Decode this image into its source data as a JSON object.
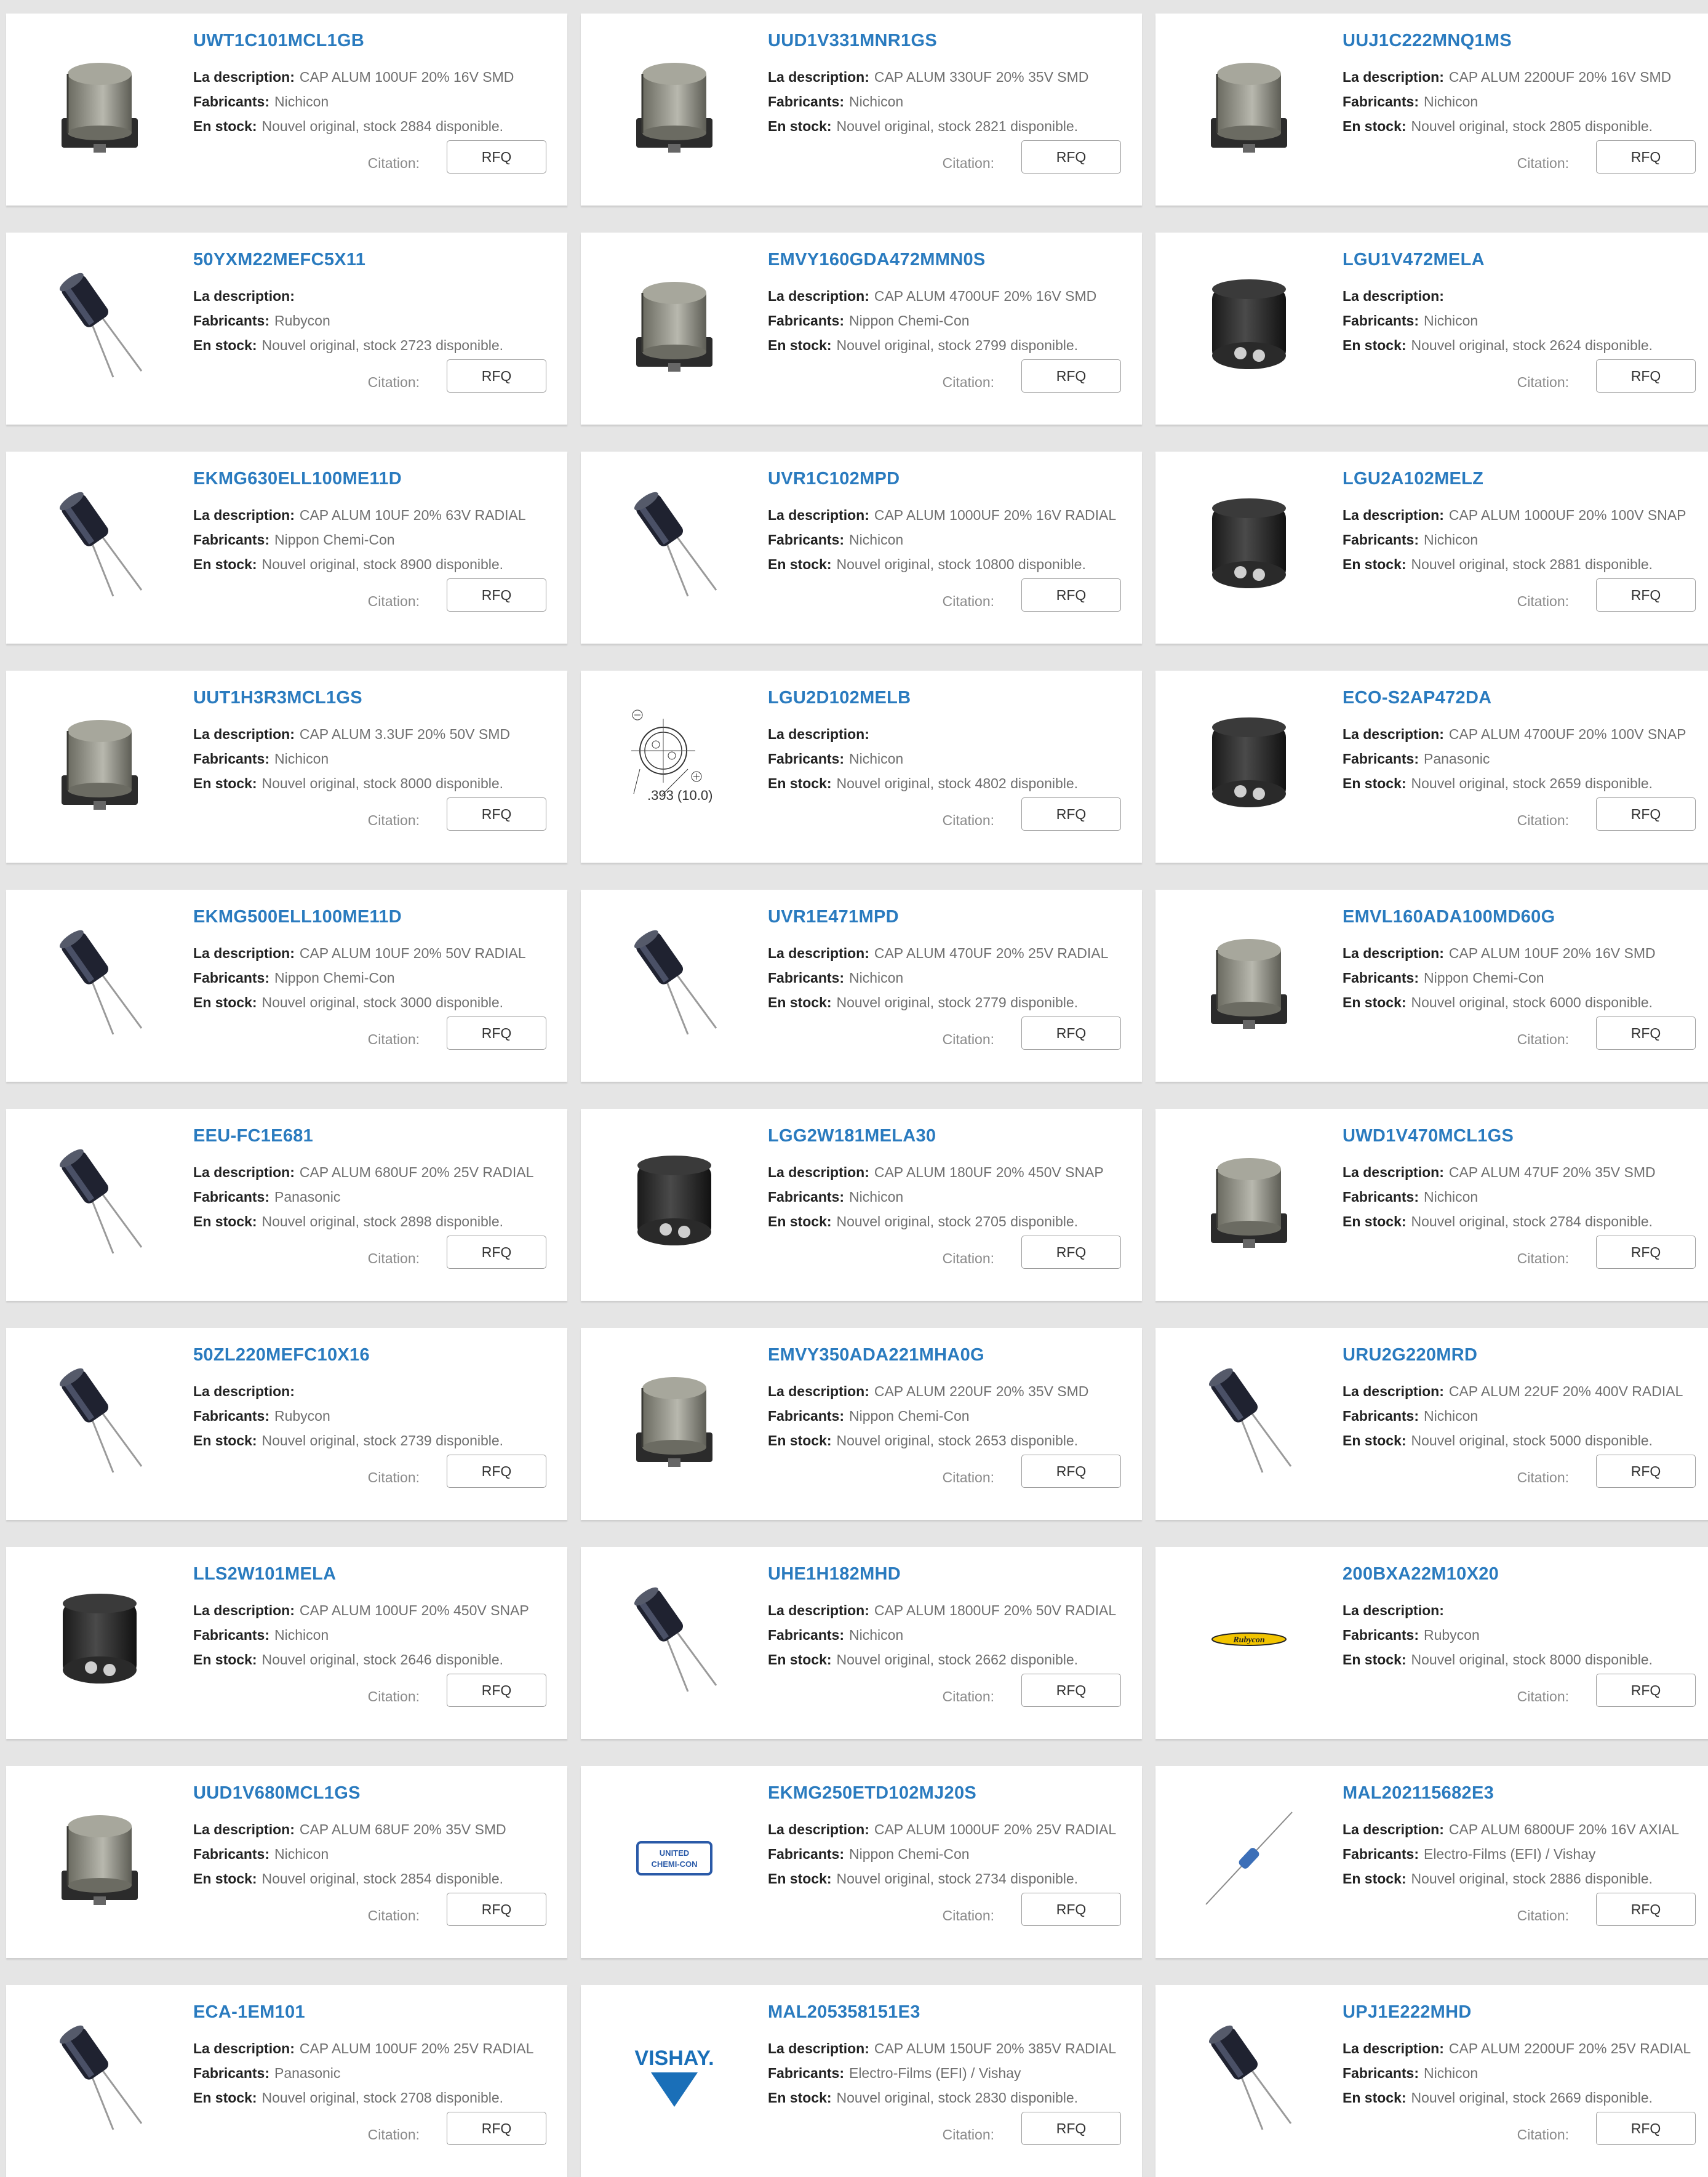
{
  "labels": {
    "description": "La description:",
    "manufacturer": "Fabricants:",
    "stock": "En stock:",
    "quote": "Citation:",
    "rfq": "RFQ"
  },
  "products": [
    {
      "part": "UWT1C101MCL1GB",
      "desc": "CAP ALUM 100UF 20% 16V SMD",
      "mfr": "Nichicon",
      "stock": "Nouvel original, stock 2884 disponible.",
      "icon": "smd-capacitor-icon"
    },
    {
      "part": "UUD1V331MNR1GS",
      "desc": "CAP ALUM 330UF 20% 35V SMD",
      "mfr": "Nichicon",
      "stock": "Nouvel original, stock 2821 disponible.",
      "icon": "smd-capacitor-icon"
    },
    {
      "part": "UUJ1C222MNQ1MS",
      "desc": "CAP ALUM 2200UF 20% 16V SMD",
      "mfr": "Nichicon",
      "stock": "Nouvel original, stock 2805 disponible.",
      "icon": "smd-capacitor-icon"
    },
    {
      "part": "50YXM22MEFC5X11",
      "desc": "",
      "mfr": "Rubycon",
      "stock": "Nouvel original, stock 2723 disponible.",
      "icon": "radial-capacitor-icon"
    },
    {
      "part": "EMVY160GDA472MMN0S",
      "desc": "CAP ALUM 4700UF 20% 16V SMD",
      "mfr": "Nippon Chemi-Con",
      "stock": "Nouvel original, stock 2799 disponible.",
      "icon": "smd-capacitor-icon"
    },
    {
      "part": "LGU1V472MELA",
      "desc": "",
      "mfr": "Nichicon",
      "stock": "Nouvel original, stock 2624 disponible.",
      "icon": "snap-in-capacitor-icon"
    },
    {
      "part": "EKMG630ELL100ME11D",
      "desc": "CAP ALUM 10UF 20% 63V RADIAL",
      "mfr": "Nippon Chemi-Con",
      "stock": "Nouvel original, stock 8900 disponible.",
      "icon": "radial-capacitor-icon"
    },
    {
      "part": "UVR1C102MPD",
      "desc": "CAP ALUM 1000UF 20% 16V RADIAL",
      "mfr": "Nichicon",
      "stock": "Nouvel original, stock 10800 disponible.",
      "icon": "radial-capacitor-icon"
    },
    {
      "part": "LGU2A102MELZ",
      "desc": "CAP ALUM 1000UF 20% 100V SNAP",
      "mfr": "Nichicon",
      "stock": "Nouvel original, stock 2881 disponible.",
      "icon": "snap-in-capacitor-icon"
    },
    {
      "part": "UUT1H3R3MCL1GS",
      "desc": "CAP ALUM 3.3UF 20% 50V SMD",
      "mfr": "Nichicon",
      "stock": "Nouvel original, stock 8000 disponible.",
      "icon": "smd-capacitor-icon"
    },
    {
      "part": "LGU2D102MELB",
      "desc": "",
      "mfr": "Nichicon",
      "stock": "Nouvel original, stock 4802 disponible.",
      "icon": "dimension-drawing-icon",
      "drawing_text": ".393 (10.0)"
    },
    {
      "part": "ECO-S2AP472DA",
      "desc": "CAP ALUM 4700UF 20% 100V SNAP",
      "mfr": "Panasonic",
      "stock": "Nouvel original, stock 2659 disponible.",
      "icon": "snap-in-capacitor-icon"
    },
    {
      "part": "EKMG500ELL100ME11D",
      "desc": "CAP ALUM 10UF 20% 50V RADIAL",
      "mfr": "Nippon Chemi-Con",
      "stock": "Nouvel original, stock 3000 disponible.",
      "icon": "radial-capacitor-icon"
    },
    {
      "part": "UVR1E471MPD",
      "desc": "CAP ALUM 470UF 20% 25V RADIAL",
      "mfr": "Nichicon",
      "stock": "Nouvel original, stock 2779 disponible.",
      "icon": "radial-capacitor-icon"
    },
    {
      "part": "EMVL160ADA100MD60G",
      "desc": "CAP ALUM 10UF 20% 16V SMD",
      "mfr": "Nippon Chemi-Con",
      "stock": "Nouvel original, stock 6000 disponible.",
      "icon": "smd-capacitor-icon"
    },
    {
      "part": "EEU-FC1E681",
      "desc": "CAP ALUM 680UF 20% 25V RADIAL",
      "mfr": "Panasonic",
      "stock": "Nouvel original, stock 2898 disponible.",
      "icon": "radial-capacitor-icon"
    },
    {
      "part": "LGG2W181MELA30",
      "desc": "CAP ALUM 180UF 20% 450V SNAP",
      "mfr": "Nichicon",
      "stock": "Nouvel original, stock 2705 disponible.",
      "icon": "snap-in-capacitor-icon"
    },
    {
      "part": "UWD1V470MCL1GS",
      "desc": "CAP ALUM 47UF 20% 35V SMD",
      "mfr": "Nichicon",
      "stock": "Nouvel original, stock 2784 disponible.",
      "icon": "smd-capacitor-icon"
    },
    {
      "part": "50ZL220MEFC10X16",
      "desc": "",
      "mfr": "Rubycon",
      "stock": "Nouvel original, stock 2739 disponible.",
      "icon": "radial-capacitor-icon"
    },
    {
      "part": "EMVY350ADA221MHA0G",
      "desc": "CAP ALUM 220UF 20% 35V SMD",
      "mfr": "Nippon Chemi-Con",
      "stock": "Nouvel original, stock 2653 disponible.",
      "icon": "smd-capacitor-icon"
    },
    {
      "part": "URU2G220MRD",
      "desc": "CAP ALUM 22UF 20% 400V RADIAL",
      "mfr": "Nichicon",
      "stock": "Nouvel original, stock 5000 disponible.",
      "icon": "radial-capacitor-icon"
    },
    {
      "part": "LLS2W101MELA",
      "desc": "CAP ALUM 100UF 20% 450V SNAP",
      "mfr": "Nichicon",
      "stock": "Nouvel original, stock 2646 disponible.",
      "icon": "snap-in-capacitor-icon"
    },
    {
      "part": "UHE1H182MHD",
      "desc": "CAP ALUM 1800UF 20% 50V RADIAL",
      "mfr": "Nichicon",
      "stock": "Nouvel original, stock 2662 disponible.",
      "icon": "radial-capacitor-icon"
    },
    {
      "part": "200BXA22M10X20",
      "desc": "",
      "mfr": "Rubycon",
      "stock": "Nouvel original, stock 8000 disponible.",
      "icon": "rubycon-logo-icon",
      "logo_text": "Rubycon"
    },
    {
      "part": "UUD1V680MCL1GS",
      "desc": "CAP ALUM 68UF 20% 35V SMD",
      "mfr": "Nichicon",
      "stock": "Nouvel original, stock 2854 disponible.",
      "icon": "smd-capacitor-icon"
    },
    {
      "part": "EKMG250ETD102MJ20S",
      "desc": "CAP ALUM 1000UF 20% 25V RADIAL",
      "mfr": "Nippon Chemi-Con",
      "stock": "Nouvel original, stock 2734 disponible.",
      "icon": "chemicon-logo-icon",
      "logo_text": "UNITED CHEMI-CON"
    },
    {
      "part": "MAL202115682E3",
      "desc": "CAP ALUM 6800UF 20% 16V AXIAL",
      "mfr": "Electro-Films (EFI) / Vishay",
      "stock": "Nouvel original, stock 2886 disponible.",
      "icon": "axial-capacitor-icon"
    },
    {
      "part": "ECA-1EM101",
      "desc": "CAP ALUM 100UF 20% 25V RADIAL",
      "mfr": "Panasonic",
      "stock": "Nouvel original, stock 2708 disponible.",
      "icon": "radial-capacitor-icon"
    },
    {
      "part": "MAL205358151E3",
      "desc": "CAP ALUM 150UF 20% 385V RADIAL",
      "mfr": "Electro-Films (EFI) / Vishay",
      "stock": "Nouvel original, stock 2830 disponible.",
      "icon": "vishay-logo-icon",
      "logo_text": "VISHAY."
    },
    {
      "part": "UPJ1E222MHD",
      "desc": "CAP ALUM 2200UF 20% 25V RADIAL",
      "mfr": "Nichicon",
      "stock": "Nouvel original, stock 2669 disponible.",
      "icon": "radial-capacitor-icon"
    }
  ]
}
